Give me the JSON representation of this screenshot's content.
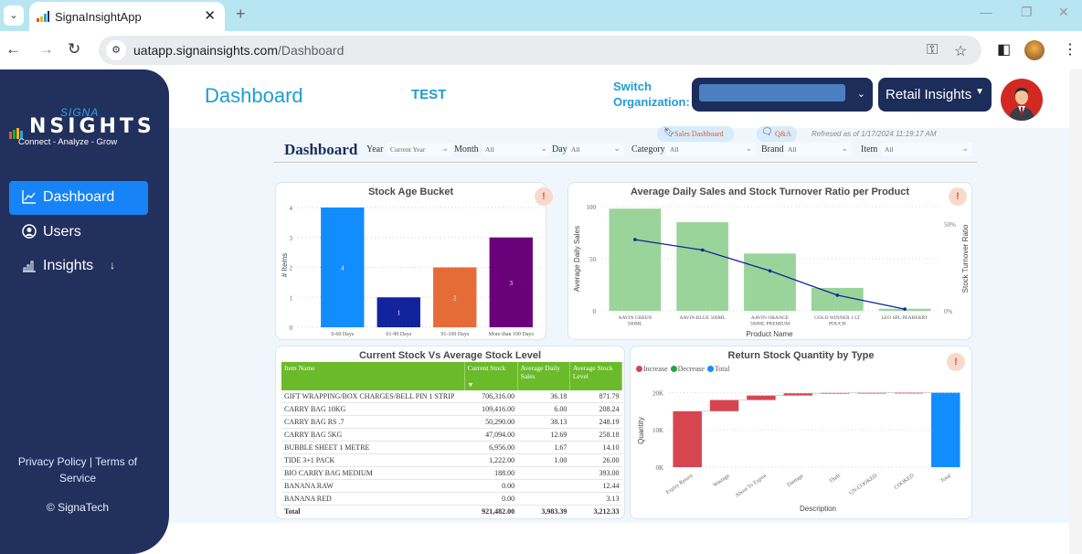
{
  "browser": {
    "tab_title": "SignaInsightApp",
    "url_host": "uatapp.signainsights.com",
    "url_path": "/Dashboard",
    "icons": [
      "tab-search-icon",
      "close-icon",
      "new-tab-icon",
      "back-icon",
      "forward-icon",
      "reload-icon",
      "site-settings-icon",
      "password-key-icon",
      "bookmark-star-icon",
      "side-panel-icon",
      "profile-avatar",
      "more-menu-icon",
      "minimize-icon",
      "restore-icon",
      "window-close-icon"
    ]
  },
  "sidebar": {
    "logo": {
      "signa": "SIGNA",
      "insights": "NSIGHTS",
      "tagline": "Connect - Analyze - Grow"
    },
    "items": [
      {
        "label": "Dashboard",
        "icon": "line-chart-icon",
        "active": true
      },
      {
        "label": "Users",
        "icon": "user-circle-icon",
        "active": false
      },
      {
        "label": "Insights",
        "icon": "bar-chart-icon",
        "active": false,
        "suffix": "↓"
      }
    ],
    "footer": {
      "privacy": "Privacy Policy",
      "separator": "|",
      "terms": "Terms of Service",
      "copyright": "© SignaTech"
    }
  },
  "header": {
    "title": "Dashboard",
    "org_name": "TEST",
    "switch_label_1": "Switch",
    "switch_label_2": "Organization:",
    "org_select_value": "",
    "module_button": "Retail Insights"
  },
  "report": {
    "sales_dashboard_link": "Sales Dashboard",
    "qa_link": "Q&A",
    "refreshed": "Refresed as of 1/17/2024 11:19:17 AM",
    "title": "Dashboard",
    "filters": [
      {
        "label": "Year",
        "value": "Current Year"
      },
      {
        "label": "Month",
        "value": "All"
      },
      {
        "label": "Day",
        "value": "All"
      },
      {
        "label": "Category",
        "value": "All"
      },
      {
        "label": "Brand",
        "value": "All"
      },
      {
        "label": "Item",
        "value": "All"
      }
    ]
  },
  "chart_data": [
    {
      "id": "stock-age",
      "type": "bar",
      "title": "Stock Age Bucket",
      "xlabel": "",
      "ylabel": "# Items",
      "ylim": [
        0,
        4
      ],
      "yticks": [
        0,
        1,
        2,
        3,
        4
      ],
      "categories": [
        "0-60 Days",
        "61-90 Days",
        "91-100 Days",
        "More than 100 Days"
      ],
      "values": [
        4,
        1,
        2,
        3
      ],
      "colors": [
        "#118dff",
        "#12239e",
        "#e66c37",
        "#6b007b"
      ],
      "data_labels": true,
      "grid": true
    },
    {
      "id": "daily-sales",
      "type": "bar",
      "title": "Average Daily Sales and Stock Turnover Ratio per Product",
      "xlabel": "Product Name",
      "ylabel": "Average Daily Sales",
      "y2label": "Stock Turnover Ratio",
      "ylim": [
        0,
        100
      ],
      "yticks": [
        0,
        50,
        100
      ],
      "y2lim": [
        0,
        0.6
      ],
      "y2ticks": [
        {
          "v": 0,
          "label": "0%"
        },
        {
          "v": 0.5,
          "label": "50%"
        }
      ],
      "categories": [
        "AAVIN GREEN 500ML",
        "AAVIN BLUE 500ML",
        "AAVIN ORANGE 500ML PREMIUM",
        "GOLD WINNER 1 LT POUCH",
        "LEO SPL PEABERRY"
      ],
      "category_lines": [
        [
          "AAVIN GREEN",
          "500ML"
        ],
        [
          "AAVIN BLUE 500ML"
        ],
        [
          "AAVIN ORANGE",
          "500ML PREMIUM"
        ],
        [
          "GOLD WINNER 1 LT",
          "POUCH"
        ],
        [
          "LEO SPL PEABERRY"
        ]
      ],
      "series": [
        {
          "name": "Average Daily Sales",
          "type": "bar",
          "color": "#9ad49a",
          "values": [
            98,
            85,
            55,
            22,
            2
          ]
        },
        {
          "name": "Stock Turnover Ratio",
          "type": "line",
          "color": "#12239e",
          "values": [
            0.41,
            0.35,
            0.23,
            0.09,
            0.01
          ]
        }
      ],
      "grid": true
    },
    {
      "id": "return-stock",
      "type": "bar",
      "subtype": "waterfall",
      "title": "Return Stock Quantity by Type",
      "xlabel": "Description",
      "ylabel": "Quantity",
      "ylim": [
        0,
        25000
      ],
      "yticks": [
        {
          "v": 0,
          "label": "0K"
        },
        {
          "v": 10000,
          "label": "10K"
        },
        {
          "v": 20000,
          "label": "20K"
        }
      ],
      "legend": [
        {
          "name": "Increase",
          "color": "#d64550"
        },
        {
          "name": "Decrease",
          "color": "#1aab40"
        },
        {
          "name": "Total",
          "color": "#118dff"
        }
      ],
      "legend_position": "top-left",
      "categories": [
        "Expiry Return",
        "Wastage",
        "About To Expire",
        "Damage",
        "Theft",
        "UN-COOKED",
        "COOKED",
        "Total"
      ],
      "values": [
        15000,
        3000,
        1200,
        600,
        100,
        30,
        20,
        19950
      ],
      "kinds": [
        "increase",
        "increase",
        "increase",
        "increase",
        "increase",
        "increase",
        "increase",
        "total"
      ],
      "grid": true
    }
  ],
  "stock_table": {
    "title": "Current Stock Vs Average Stock Level",
    "columns": [
      "Item Name",
      "Current Stock",
      "Average Daily Sales",
      "Average Stock Level"
    ],
    "sort_indicator": "▼",
    "rows": [
      [
        "GIFT WRAPPING/BOX CHARGES/BELL PIN 1 STRIP",
        "706,316.00",
        "36.18",
        "871.79"
      ],
      [
        "CARRY BAG 10KG",
        "109,416.00",
        "6.00",
        "208.24"
      ],
      [
        "CARRY BAG RS .7",
        "50,290.00",
        "38.13",
        "248.19"
      ],
      [
        "CARRY BAG 5KG",
        "47,094.00",
        "12.69",
        "258.18"
      ],
      [
        "BUBBLE SHEET 1 METRE",
        "6,956.00",
        "1.67",
        "14.10"
      ],
      [
        "TIDE 3+1 PACK",
        "1,222.00",
        "1.00",
        "26.00"
      ],
      [
        "BIO CARRY BAG MEDIUM",
        "188.00",
        "",
        "393.00"
      ],
      [
        "BANANA RAW",
        "0.00",
        "",
        "12.44"
      ],
      [
        "BANANA RED",
        "0.00",
        "",
        "3.13"
      ]
    ],
    "total": [
      "Total",
      "921,482.00",
      "3,983.39",
      "3,212.33"
    ]
  }
}
